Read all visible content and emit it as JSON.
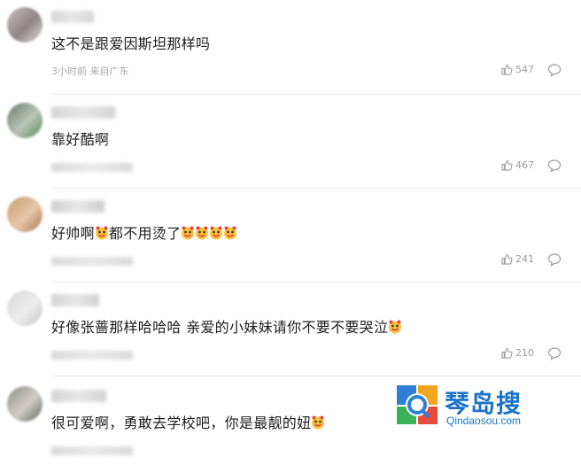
{
  "comments": [
    {
      "text_before": "这不是跟爱因斯坦那样吗",
      "emojis_mid": 0,
      "text_after": "",
      "emojis_end": 0,
      "meta": "3小时前 来自广东",
      "likes": "547",
      "avatar_colors": [
        "#c7bdbd",
        "#8f8585",
        "#e2dada"
      ],
      "username_color": "#c9c9c9"
    },
    {
      "text_before": "靠好酷啊",
      "emojis_mid": 0,
      "text_after": "",
      "emojis_end": 0,
      "meta": "",
      "likes": "467",
      "avatar_colors": [
        "#6b7b6b",
        "#b9c3b6",
        "#4e8f55"
      ],
      "username_color": "#c6c6c6"
    },
    {
      "text_before": "好帅啊",
      "emojis_mid": 1,
      "text_after": "都不用烫了",
      "emojis_end": 4,
      "meta": "",
      "likes": "241",
      "avatar_colors": [
        "#c79a72",
        "#e6c6a8",
        "#a87553"
      ],
      "username_color": "#bdbdbd"
    },
    {
      "text_before": "好像张蔷那样哈哈哈 亲爱的小妹妹请你不要不要哭泣",
      "emojis_mid": 0,
      "text_after": "",
      "emojis_end": 1,
      "meta": "",
      "likes": "210",
      "avatar_colors": [
        "#d7d7d7",
        "#ececec",
        "#c4c4c4"
      ],
      "username_color": "#c2c2c2"
    },
    {
      "text_before": "很可爱啊，勇敢去学校吧，你是最靓的妞",
      "emojis_mid": 0,
      "text_after": "",
      "emojis_end": 1,
      "meta": "",
      "likes": "",
      "avatar_colors": [
        "#8a8f86",
        "#d0cbc5",
        "#5f6b5c"
      ],
      "username_color": "#c4c4c4"
    }
  ],
  "icons": {
    "like": "thumbs-up-icon",
    "reply": "comment-bubble-icon",
    "emoji": "smiley-emoji-icon"
  },
  "watermark": {
    "brand_cn": "琴岛搜",
    "brand_en": "Qindaosou.com"
  },
  "colors": {
    "accent": "#1a73c9",
    "emoji_face": "#f4c542",
    "emoji_red": "#e8453c"
  }
}
